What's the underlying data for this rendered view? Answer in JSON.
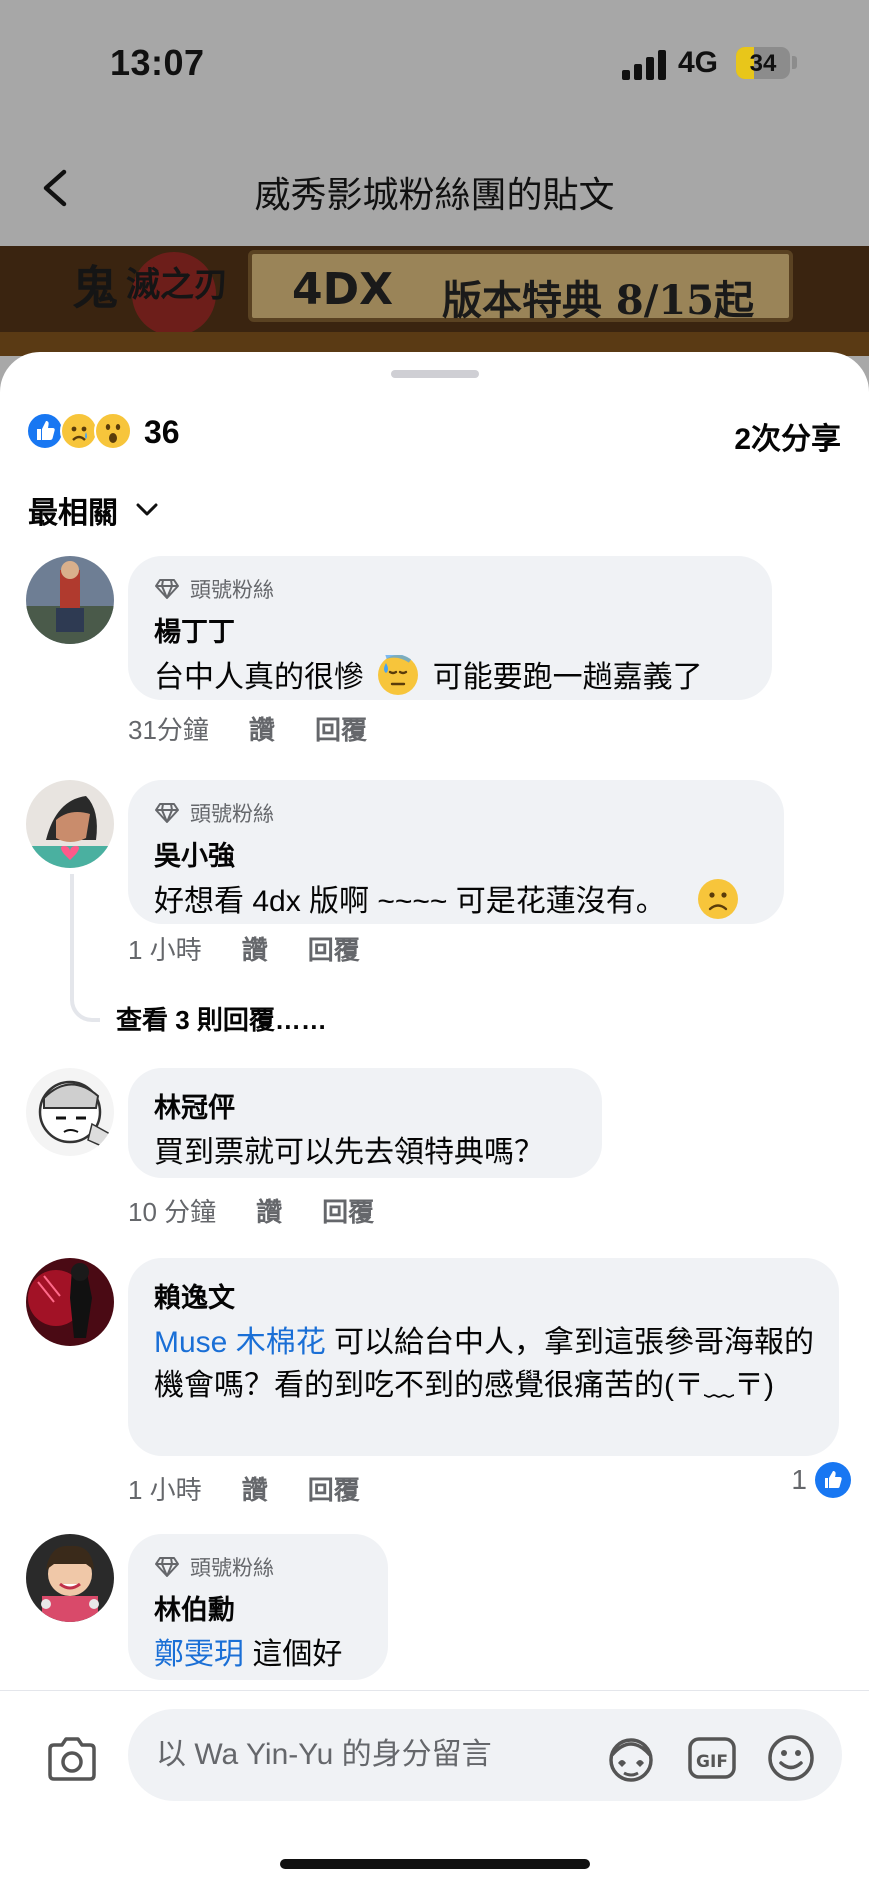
{
  "status_bar": {
    "time": "13:07",
    "network": "4G",
    "battery": "34",
    "battery_level": 0.34
  },
  "header": {
    "title": "威秀影城粉絲團的貼文"
  },
  "banner": {
    "brand": "4DX",
    "text": "版本特典 8/15起"
  },
  "post_stats": {
    "reaction_count": "36",
    "reactions": [
      "like-icon",
      "sad-icon",
      "wow-icon"
    ],
    "shares": "2次分享"
  },
  "sort": {
    "label": "最相關"
  },
  "comments": [
    {
      "badge": "頭號粉絲",
      "author": "楊丁丁",
      "text_before": "台中人真的很慘",
      "emoji": "sweat-emoji",
      "text_after": "可能要跑一趟嘉義了",
      "time": "31分鐘",
      "like": "讚",
      "reply": "回覆"
    },
    {
      "badge": "頭號粉絲",
      "author": "吳小強",
      "text_before": "好想看 4dx 版啊 ~~~~ 可是花蓮沒有。",
      "emoji": "frown-emoji",
      "time": "1 小時",
      "like": "讚",
      "reply": "回覆"
    },
    {
      "author": "林冠伻",
      "text": "買到票就可以先去領特典嗎？",
      "time": "10 分鐘",
      "like": "讚",
      "reply": "回覆"
    },
    {
      "author": "賴逸文",
      "mention": "Muse 木棉花",
      "text": " 可以給台中人，拿到這張參哥海報的機會嗎？看的到吃不到的感覺很痛苦的(〒﹏〒)",
      "time": "1 小時",
      "like": "讚",
      "reply": "回覆",
      "likes": "1"
    },
    {
      "badge": "頭號粉絲",
      "author": "林伯勳",
      "mention": "鄭雯玥",
      "text": " 這個好"
    }
  ],
  "view_replies": "查看 3 則回覆……",
  "composer": {
    "placeholder": "以 Wa Yin-Yu 的身分留言"
  },
  "colors": {
    "accent": "#1877f2",
    "bubble": "#f0f2f5",
    "mention": "#1a6fd6",
    "meta": "#65676b"
  }
}
